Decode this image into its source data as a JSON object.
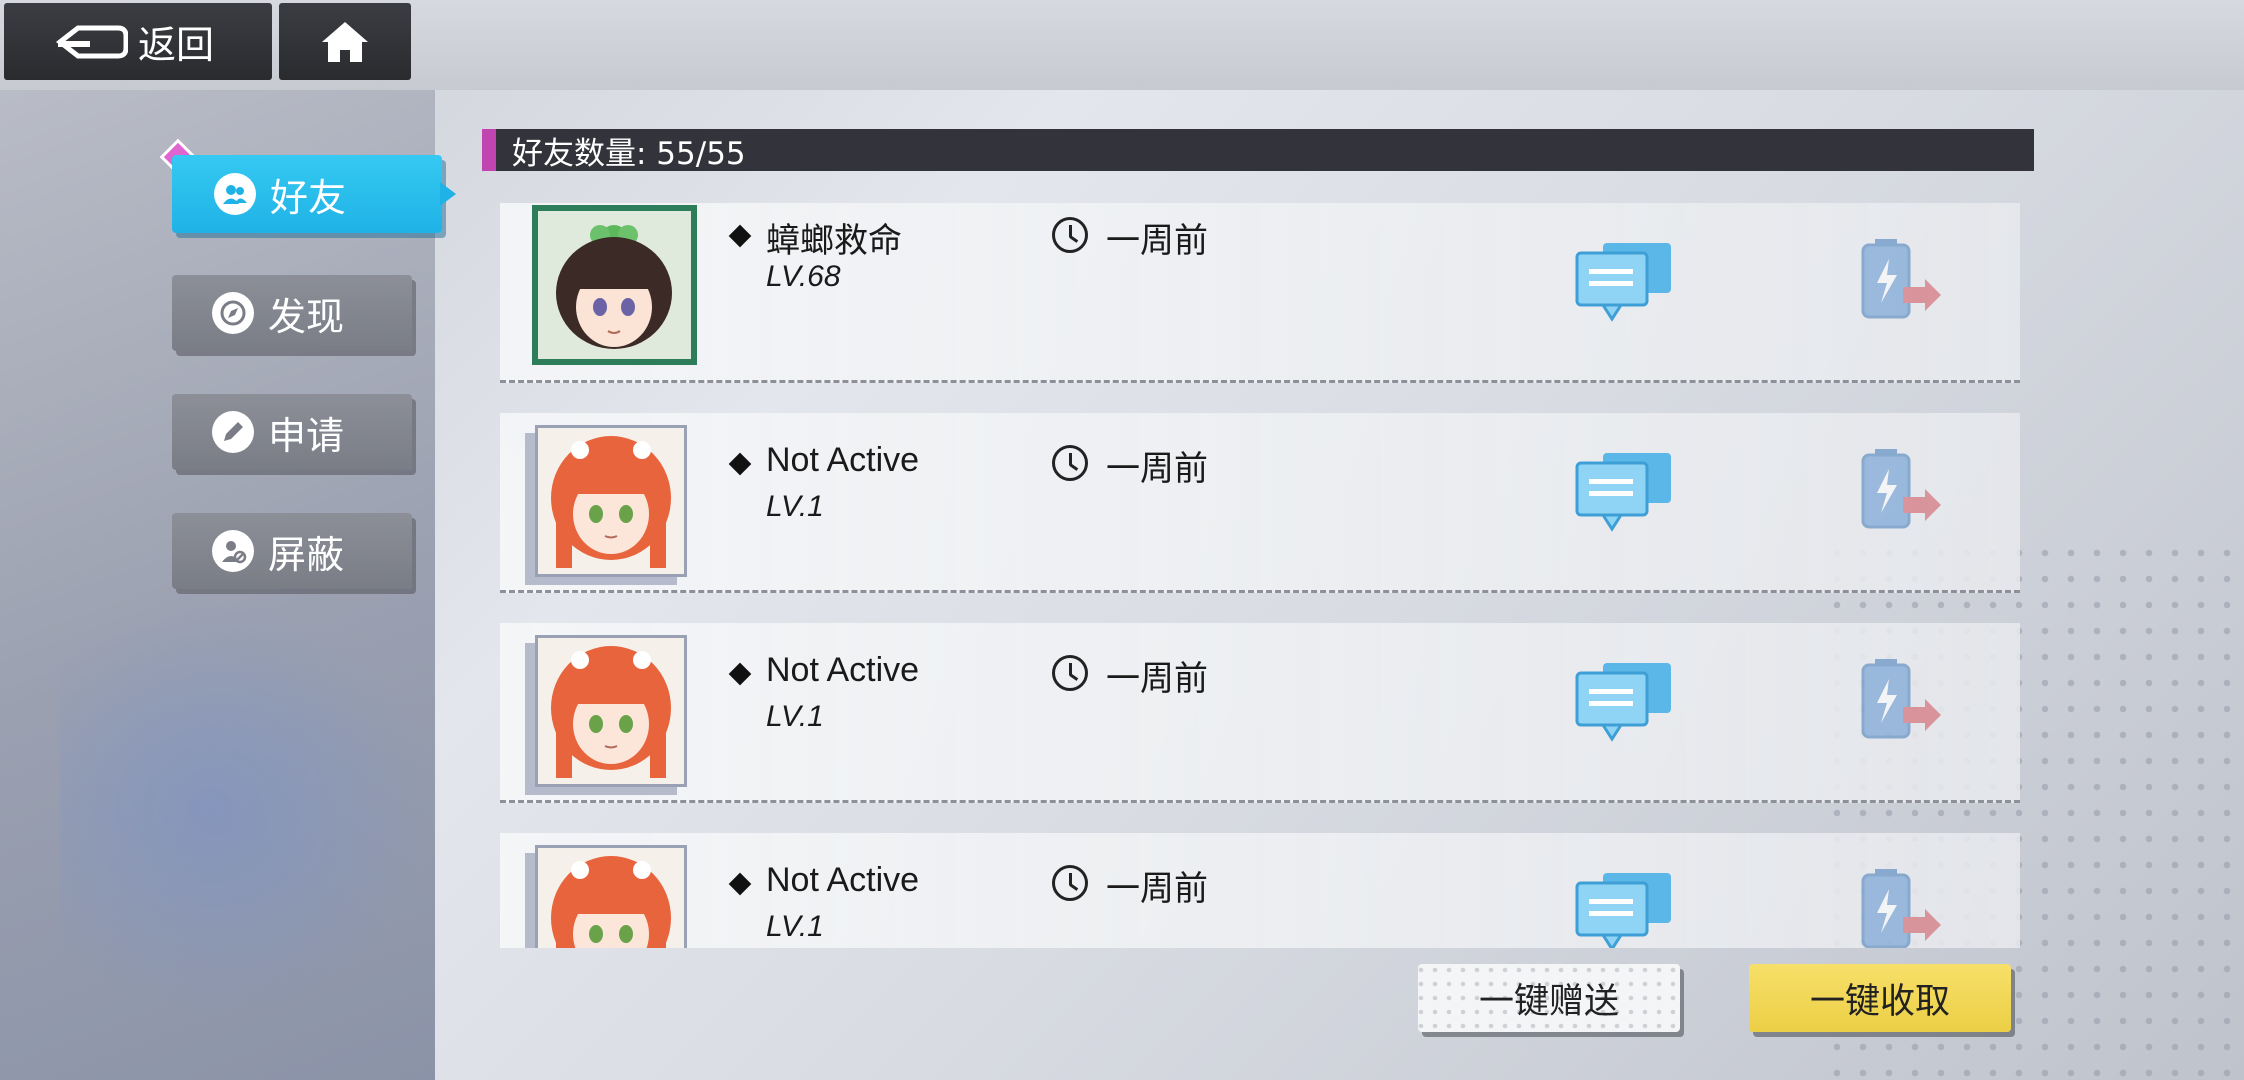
{
  "topbar": {
    "back_label": "返回",
    "back_icon": "back-arrow-icon",
    "home_icon": "home-icon"
  },
  "nav": {
    "items": [
      {
        "label": "好友",
        "icon": "friends-icon",
        "active": true
      },
      {
        "label": "发现",
        "icon": "discover-icon",
        "active": false
      },
      {
        "label": "申请",
        "icon": "request-icon",
        "active": false
      },
      {
        "label": "屏蔽",
        "icon": "block-icon",
        "active": false
      }
    ]
  },
  "header": {
    "title": "好友数量: 55/55"
  },
  "friends": [
    {
      "name": "蟑螂救命",
      "level": "LV.68",
      "last_seen": "一周前",
      "avatar": "dark-hair-girl-avatar"
    },
    {
      "name": "Not Active",
      "level": "LV.1",
      "last_seen": "一周前",
      "avatar": "orange-hair-girl-avatar"
    },
    {
      "name": "Not Active",
      "level": "LV.1",
      "last_seen": "一周前",
      "avatar": "orange-hair-girl-avatar"
    },
    {
      "name": "Not Active",
      "level": "LV.1",
      "last_seen": "一周前",
      "avatar": "orange-hair-girl-avatar"
    }
  ],
  "buttons": {
    "send_all": "一键赠送",
    "collect_all": "一键收取"
  },
  "colors": {
    "accent_blue": "#1fb2e6",
    "accent_yellow": "#eccf45",
    "header_bg": "#33343b",
    "header_marker": "#c045b0"
  }
}
